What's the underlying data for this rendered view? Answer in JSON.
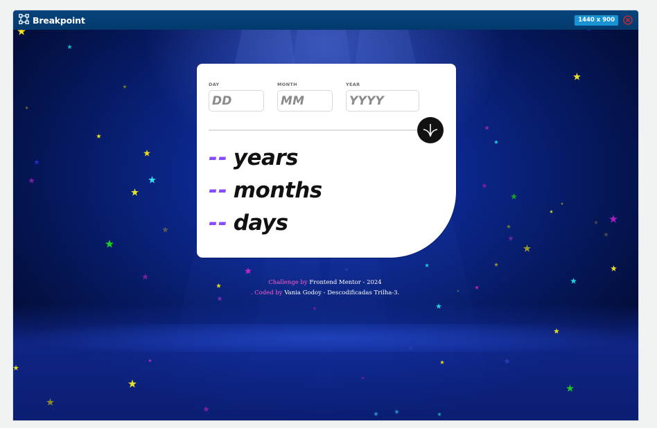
{
  "app": {
    "title": "Breakpoint",
    "viewport_size": "1440 x 900",
    "accent_color": "#1a93d4",
    "close_color": "#e0242f"
  },
  "form": {
    "day_label": "DAY",
    "day_placeholder": "DD",
    "month_label": "MONTH",
    "month_placeholder": "MM",
    "year_label": "YEAR",
    "year_placeholder": "YYYY",
    "submit_icon": "arrow-down-icon"
  },
  "results": {
    "years_value": "--",
    "years_label": "years",
    "months_value": "--",
    "months_label": "months",
    "days_value": "--",
    "days_label": "days",
    "accent_color": "#854dff"
  },
  "footer": {
    "challenge_prefix": "Challenge by",
    "challenge_source": "Frontend Mentor - 2024",
    "coded_prefix": ". Coded by",
    "coded_author": "Vania Godoy - Descodificadas Trilha-3."
  }
}
